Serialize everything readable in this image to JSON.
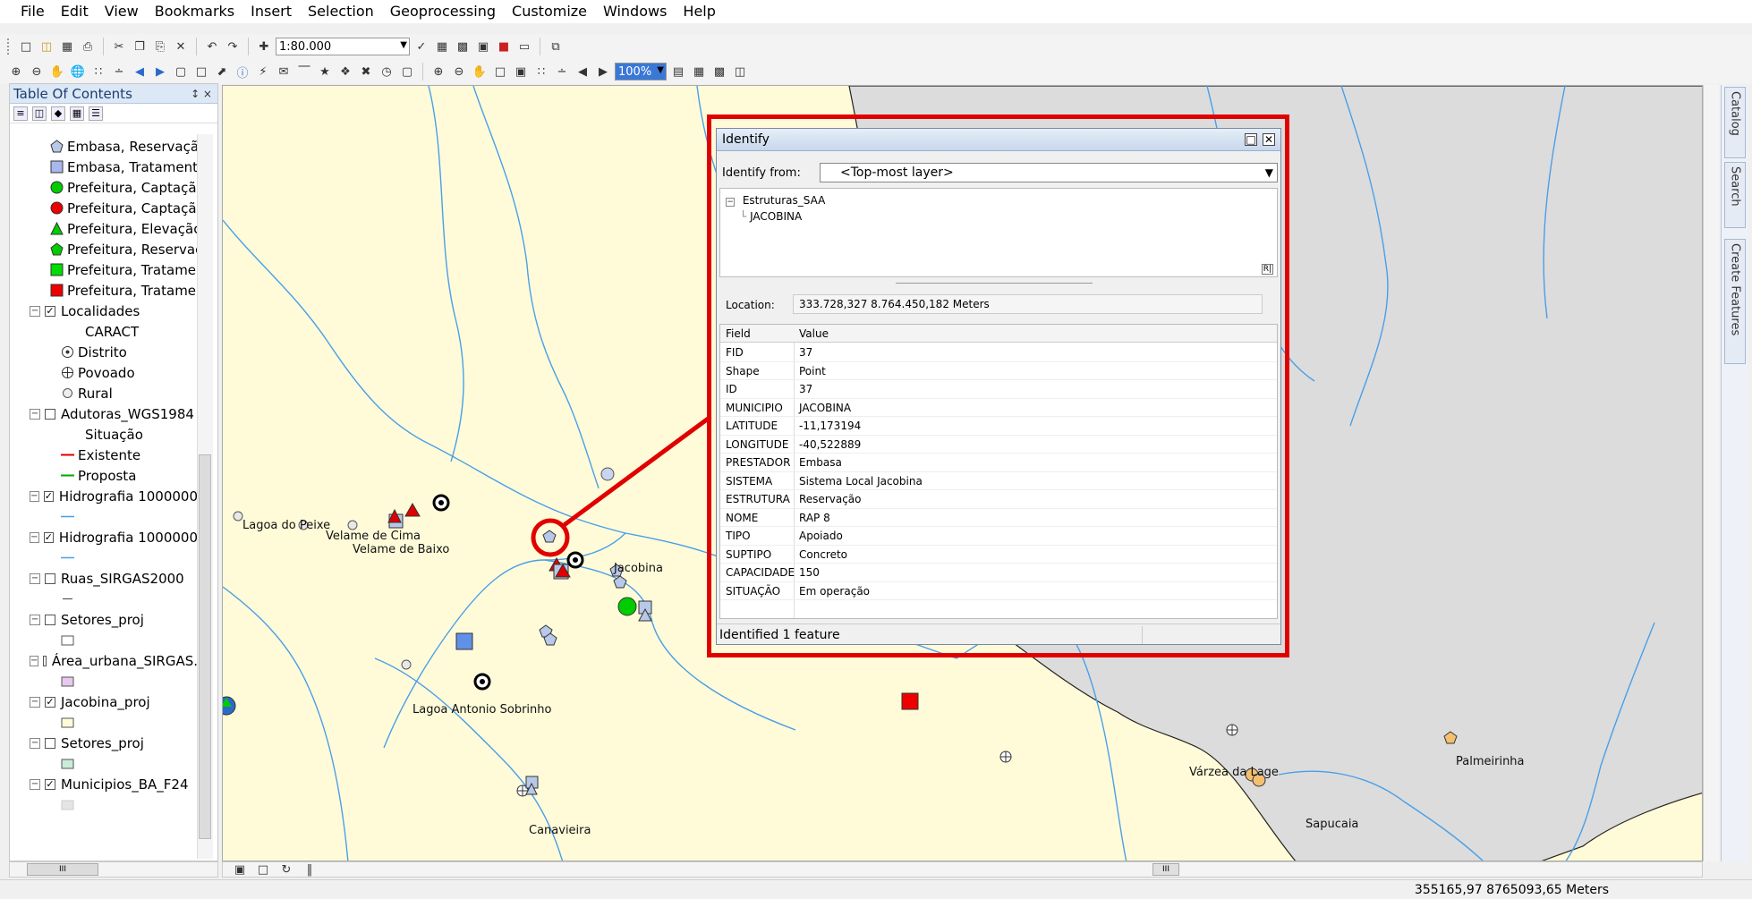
{
  "menu": [
    "File",
    "Edit",
    "View",
    "Bookmarks",
    "Insert",
    "Selection",
    "Geoprocessing",
    "Customize",
    "Windows",
    "Help"
  ],
  "toolbar": {
    "scale": "1:80.000",
    "zoom_percent": "100%"
  },
  "toc": {
    "title": "Table Of Contents",
    "pin": "↕ ×",
    "items": [
      {
        "label": "Embasa, Reservaçã",
        "symbol": "pentagon",
        "color": "#b8c8e8"
      },
      {
        "label": "Embasa, Tratament",
        "symbol": "square",
        "color": "#a8b8ee"
      },
      {
        "label": "Prefeitura, Captaçã",
        "symbol": "circle",
        "color": "#00cc00"
      },
      {
        "label": "Prefeitura, Captaçã",
        "symbol": "circle",
        "color": "#ee0000"
      },
      {
        "label": "Prefeitura, Elevaçãc",
        "symbol": "triangle",
        "color": "#00cc00"
      },
      {
        "label": "Prefeitura, Reservaç",
        "symbol": "pentagon",
        "color": "#00cc00"
      },
      {
        "label": "Prefeitura, Tratame",
        "symbol": "square",
        "color": "#00dd00"
      },
      {
        "label": "Prefeitura, Tratame",
        "symbol": "square",
        "color": "#ee0000"
      }
    ],
    "localidades": {
      "label": "Localidades",
      "field": "CARACT",
      "classes": [
        "Distrito",
        "Povoado",
        "Rural"
      ]
    },
    "adutoras": {
      "label": "Adutoras_WGS1984",
      "field": "Situação",
      "classes": [
        "Existente",
        "Proposta"
      ],
      "class_colors": [
        "#e00000",
        "#00aa00"
      ]
    },
    "layers": [
      {
        "label": "Hidrografia 1000000",
        "checked": true
      },
      {
        "label": "Hidrografia 1000000",
        "checked": true
      },
      {
        "label": "Ruas_SIRGAS2000",
        "checked": false
      },
      {
        "label": "Setores_proj",
        "checked": false
      },
      {
        "label": "Área_urbana_SIRGAS.",
        "checked": false
      },
      {
        "label": "Jacobina_proj",
        "checked": true
      },
      {
        "label": "Setores_proj",
        "checked": false
      },
      {
        "label": "Municipios_BA_F24",
        "checked": true
      }
    ]
  },
  "map": {
    "labels": {
      "lagoa_do_peixe": "Lagoa do Peixe",
      "velame_de_cima": "Velame de Cima",
      "velame_de_baixo": "Velame de Baixo",
      "jacobina": "Jacobina",
      "lagoa_antonio_sobrinho": "Lagoa Antonio Sobrinho",
      "canavieira": "Canavieira",
      "varzea_da_lage": "Várzea da Lage",
      "palmeirinha": "Palmeirinha",
      "sapucaia": "Sapucaia"
    },
    "colors": {
      "land": "#fffbd9",
      "outside": "#dcdcdc",
      "river": "#4a9fe8",
      "highlight": "#e00000"
    }
  },
  "right_dock": [
    "Catalog",
    "Search",
    "Create Features"
  ],
  "identify": {
    "title": "Identify",
    "from_label": "Identify from:",
    "from_value": "<Top-most layer>",
    "tree_layer": "Estruturas_SAA",
    "tree_feature": "JACOBINA",
    "location_label": "Location:",
    "location_value": "333.728,327  8.764.450,182 Meters",
    "header_field": "Field",
    "header_value": "Value",
    "rows": [
      {
        "field": "FID",
        "value": "37"
      },
      {
        "field": "Shape",
        "value": "Point"
      },
      {
        "field": "ID",
        "value": "37"
      },
      {
        "field": "MUNICIPIO",
        "value": "JACOBINA"
      },
      {
        "field": "LATITUDE",
        "value": "-11,173194"
      },
      {
        "field": "LONGITUDE",
        "value": "-40,522889"
      },
      {
        "field": "PRESTADOR",
        "value": "Embasa"
      },
      {
        "field": "SISTEMA",
        "value": "Sistema Local Jacobina"
      },
      {
        "field": "ESTRUTURA",
        "value": "Reservação"
      },
      {
        "field": "NOME",
        "value": "RAP 8"
      },
      {
        "field": "TIPO",
        "value": "Apoiado"
      },
      {
        "field": "SUPTIPO",
        "value": "Concreto"
      },
      {
        "field": "CAPACIDADE",
        "value": "150"
      },
      {
        "field": "SITUAÇÃO",
        "value": "Em operação"
      }
    ],
    "status": "Identified 1 feature"
  },
  "statusbar": {
    "coords": "355165,97  8765093,65 Meters"
  }
}
